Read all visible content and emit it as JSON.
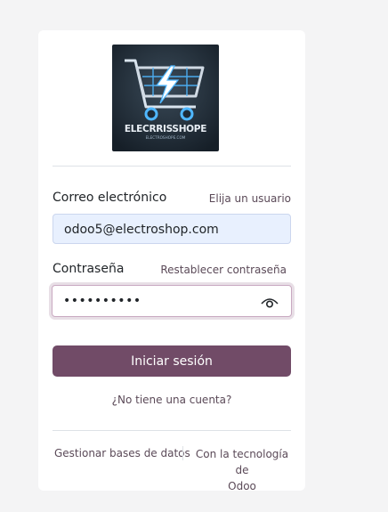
{
  "logo": {
    "brand_text": "ELECRRISSHOPE",
    "sub_text": "ELECTROSHOPE.COM",
    "accent": "#4fb7ff",
    "background": "#1d2a36"
  },
  "form": {
    "email_label": "Correo electrónico",
    "select_user_link": "Elija un usuario",
    "email_value": "odoo5@electroshop.com",
    "password_label": "Contraseña",
    "reset_password_link": "Restablecer contraseña",
    "password_mask": "••••••••••",
    "submit_label": "Iniciar sesión",
    "signup_link": "¿No tiene una cuenta?"
  },
  "footer": {
    "manage_databases": "Gestionar bases de datos",
    "powered_by_line1": "Con la tecnología de",
    "powered_by_line2": "Odoo"
  },
  "colors": {
    "primary": "#714b67",
    "email_background": "#e8f0fe",
    "link": "#5b4a58"
  }
}
